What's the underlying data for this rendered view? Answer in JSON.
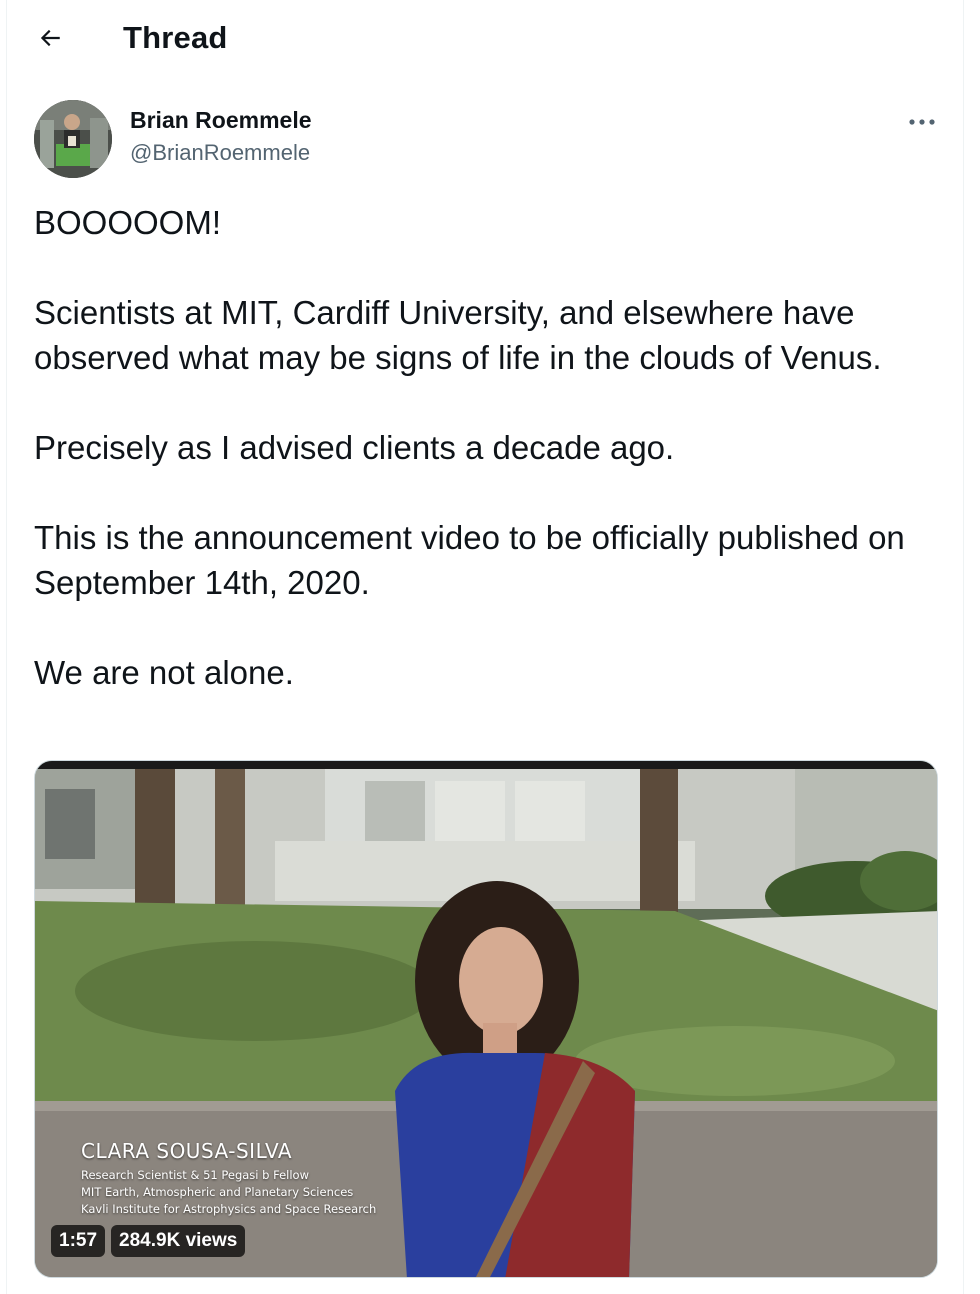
{
  "header": {
    "title": "Thread"
  },
  "tweet": {
    "author_name": "Brian Roemmele",
    "author_handle": "@BrianRoemmele",
    "paragraphs": [
      "BOOOOOM!",
      "Scientists at MIT, Cardiff University, and elsewhere have observed what may be signs of life in the clouds of Venus.",
      "Precisely as I advised clients a decade ago.",
      "This is the announcement video to be officially published on September 14th, 2020.",
      "We are not alone."
    ]
  },
  "video": {
    "lower_third": {
      "name": "CLARA SOUSA-SILVA",
      "line1": "Research Scientist & 51 Pegasi b Fellow",
      "line2": "MIT Earth, Atmospheric and Planetary Sciences",
      "line3": "Kavli Institute for Astrophysics and Space Research"
    },
    "duration": "1:57",
    "views": "284.9K views"
  },
  "icons": {
    "back": "arrow-left-icon",
    "more": "more-horizontal-icon"
  },
  "colors": {
    "text_primary": "#0f1419",
    "text_secondary": "#536471",
    "border": "#cfd9de"
  }
}
